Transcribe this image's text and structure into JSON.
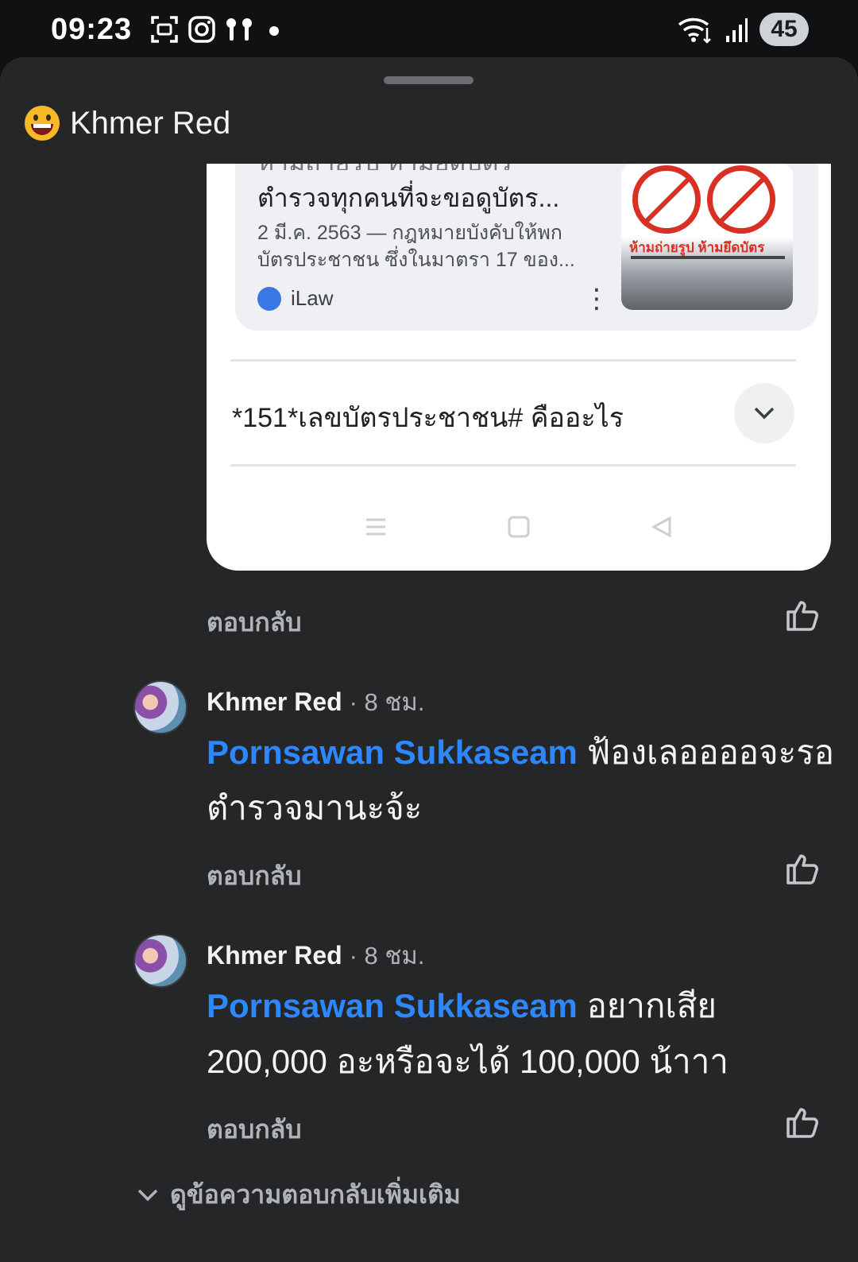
{
  "status_bar": {
    "time": "09:23",
    "battery": "45",
    "left_icons": [
      "screenshot-icon",
      "instagram-icon",
      "earbuds-icon",
      "dot-icon"
    ],
    "right_icons": [
      "wifi-icon",
      "signal-icon"
    ]
  },
  "sheet": {
    "title": "Khmer Red",
    "title_icon": "grinning-emoji-icon"
  },
  "embedded_screenshot": {
    "result_title_cut": "ห้ามถ่ายรูป ห้ามยึดบัตร",
    "result_title": "ตำรวจทุกคนที่จะขอดูบัตร...",
    "result_snippet": "2 มี.ค. 2563 — กฎหมายบังคับให้พก บัตรประชาชน ซึ่งในมาตรา 17 ของ...",
    "result_source": "iLaw",
    "thumb_caption": "ห้ามถ่ายรูป ห้ามยึดบัตร",
    "faq_question": "*151*เลขบัตรประชาชน# คืออะไร"
  },
  "reply_label": "ตอบกลับ",
  "comments": [
    {
      "author": "Khmer Red",
      "time": "· 8 ชม.",
      "mention": "Pornsawan Sukkaseam",
      "text": " ฟ้องเลออออจะรอตำรวจมานะจ้ะ"
    },
    {
      "author": "Khmer Red",
      "time": "· 8 ชม.",
      "mention": "Pornsawan Sukkaseam",
      "text": " อยากเสีย 200,000 อะหรือจะได้ 100,000 น้าาา"
    }
  ],
  "more_replies_label": "ดูข้อความตอบกลับเพิ่มเติม",
  "colors": {
    "background": "#252628",
    "mention": "#2d88ff",
    "secondary_text": "#b0b3b8"
  }
}
